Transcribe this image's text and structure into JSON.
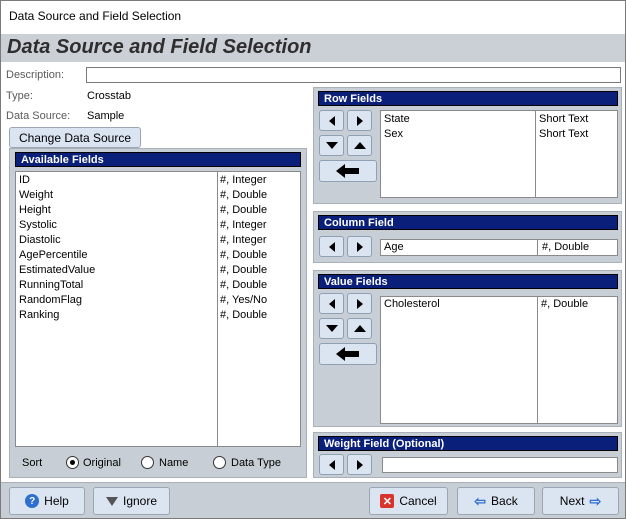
{
  "window": {
    "title": "Data Source and Field Selection"
  },
  "header": {
    "title": "Data Source and Field Selection"
  },
  "description": {
    "label": "Description:",
    "value": ""
  },
  "type": {
    "label": "Type:",
    "value": "Crosstab"
  },
  "data_source": {
    "label": "Data Source:",
    "value": "Sample"
  },
  "change_source_button": "Change Data Source",
  "available_fields": {
    "title": "Available Fields",
    "items": [
      {
        "name": "ID",
        "type": "#, Integer"
      },
      {
        "name": "Weight",
        "type": "#, Double"
      },
      {
        "name": "Height",
        "type": "#, Double"
      },
      {
        "name": "Systolic",
        "type": "#, Integer"
      },
      {
        "name": "Diastolic",
        "type": "#, Integer"
      },
      {
        "name": "AgePercentile",
        "type": "#, Double"
      },
      {
        "name": "EstimatedValue",
        "type": "#, Double"
      },
      {
        "name": "RunningTotal",
        "type": "#, Double"
      },
      {
        "name": "RandomFlag",
        "type": "#, Yes/No"
      },
      {
        "name": "Ranking",
        "type": "#, Double"
      }
    ]
  },
  "sort": {
    "label": "Sort",
    "options": [
      "Original",
      "Name",
      "Data Type"
    ],
    "selected": "Original"
  },
  "row_fields": {
    "title": "Row Fields",
    "items": [
      {
        "name": "State",
        "type": "Short Text"
      },
      {
        "name": "Sex",
        "type": "Short Text"
      }
    ]
  },
  "column_field": {
    "title": "Column Field",
    "name": "Age",
    "type": "#, Double"
  },
  "value_fields": {
    "title": "Value Fields",
    "items": [
      {
        "name": "Cholesterol",
        "type": "#, Double"
      }
    ]
  },
  "weight_field": {
    "title": "Weight Field (Optional)",
    "value": ""
  },
  "buttons": {
    "help": "Help",
    "ignore": "Ignore",
    "cancel": "Cancel",
    "back": "Back",
    "next": "Next"
  },
  "colors": {
    "panel_title_bg": "#0a1f7a",
    "panel_bg": "#c8ced5",
    "button_bg": "#dbe5f1",
    "header_bg": "#cbd0d6"
  }
}
